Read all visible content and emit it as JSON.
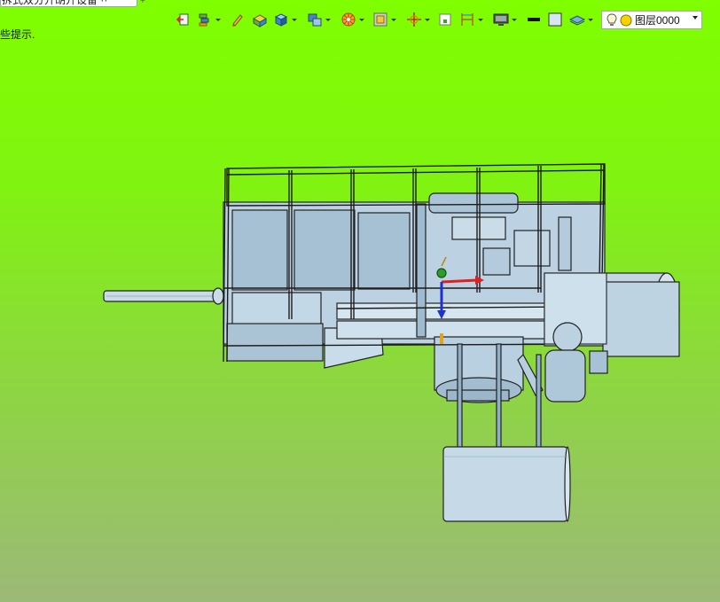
{
  "document_tab": {
    "title": "拆式双分开胡开设备 ·· ",
    "add_label": "+"
  },
  "hint_text": "些提示.",
  "toolbar": {
    "icons": [
      "exit-icon",
      "layers-stack-icon",
      "pencil-icon",
      "solid-box-icon",
      "cube-icon",
      "view-cube-icon",
      "render-wheel-icon",
      "frame-icon",
      "axis-icon",
      "fit-window-icon",
      "dimension-icon",
      "display-monitor-icon",
      "line-color-icon",
      "fill-color-icon",
      "layer-icon"
    ]
  },
  "layer_selector": {
    "value": "图层0000"
  },
  "viewport": {
    "background_top": "#7fff00",
    "background_bottom": "#9cb978",
    "model_color": "#b4cfe0",
    "triad_x_color": "#e02020",
    "triad_y_color": "#2aa02a",
    "triad_z_color": "#2030d0"
  }
}
